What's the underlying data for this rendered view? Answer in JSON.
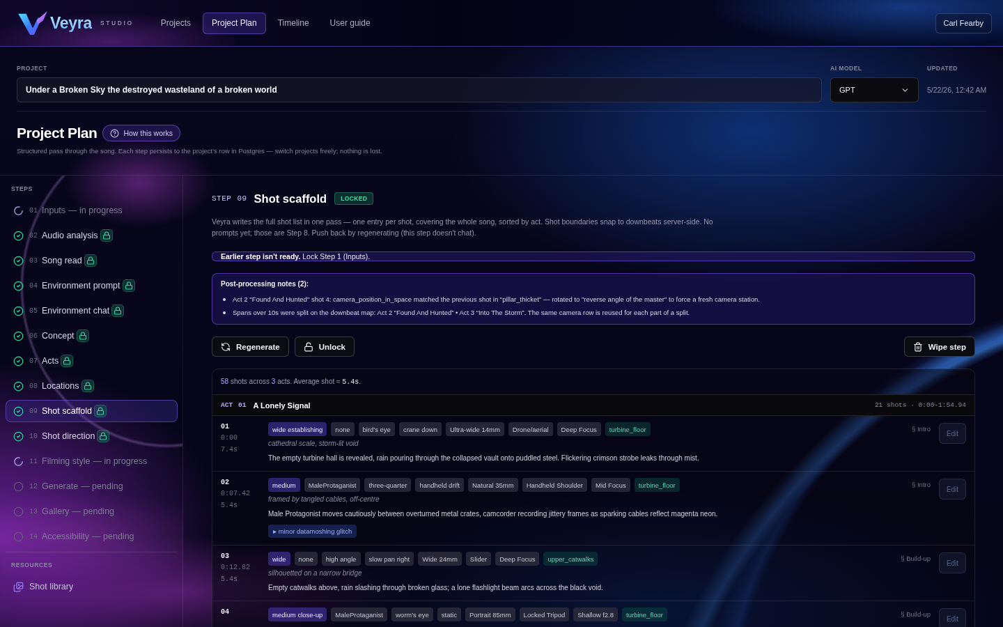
{
  "header": {
    "brand": "Veyra",
    "brand_tag": "STUDIO",
    "nav": [
      {
        "label": "Projects",
        "selected": false
      },
      {
        "label": "Project Plan",
        "selected": true
      },
      {
        "label": "Timeline",
        "selected": false
      },
      {
        "label": "User guide",
        "selected": false
      }
    ],
    "user": "Carl Fearby"
  },
  "project": {
    "name_label": "PROJECT",
    "name": "Under a Broken Sky the destroyed wasteland of a broken world",
    "model_label": "AI MODEL",
    "model": "GPT",
    "updated_label": "UPDATED",
    "updated": "5/22/26, 12:42 AM"
  },
  "page": {
    "title": "Project Plan",
    "help": "How this works",
    "subtitle": "Structured pass through the song. Each step persists to the project’s row in Postgres — switch projects freely; nothing is lost."
  },
  "sidebar": {
    "steps_label": "STEPS",
    "steps": [
      {
        "number": "01",
        "name": "Inputs",
        "note": "— in progress",
        "kind": "progress",
        "locked": false,
        "selected": false
      },
      {
        "number": "02",
        "name": "Audio analysis",
        "kind": "done",
        "locked": true,
        "selected": false
      },
      {
        "number": "03",
        "name": "Song read",
        "kind": "done",
        "locked": true,
        "selected": false
      },
      {
        "number": "04",
        "name": "Environment prompt",
        "kind": "done",
        "locked": true,
        "selected": false
      },
      {
        "number": "05",
        "name": "Environment chat",
        "kind": "done",
        "locked": true,
        "selected": false
      },
      {
        "number": "06",
        "name": "Concept",
        "kind": "done",
        "locked": true,
        "selected": false
      },
      {
        "number": "07",
        "name": "Acts",
        "kind": "done",
        "locked": true,
        "selected": false
      },
      {
        "number": "08",
        "name": "Locations",
        "kind": "done",
        "locked": true,
        "selected": false
      },
      {
        "number": "09",
        "name": "Shot scaffold",
        "kind": "done",
        "locked": true,
        "selected": true
      },
      {
        "number": "10",
        "name": "Shot direction",
        "kind": "done",
        "locked": true,
        "selected": false
      },
      {
        "number": "11",
        "name": "Filming style",
        "note": "— in progress",
        "kind": "progress",
        "locked": false,
        "selected": false
      },
      {
        "number": "12",
        "name": "Generate",
        "note": "— pending",
        "kind": "pending",
        "locked": false,
        "selected": false
      },
      {
        "number": "13",
        "name": "Gallery",
        "note": "— pending",
        "kind": "pending",
        "locked": false,
        "selected": false
      },
      {
        "number": "14",
        "name": "Accessibility",
        "note": "— pending",
        "kind": "pending",
        "locked": false,
        "selected": false
      }
    ],
    "resources_label": "RESOURCES",
    "resources": [
      {
        "label": "Shot library"
      }
    ]
  },
  "step": {
    "prefix": "STEP",
    "number": "09",
    "title": "Shot scaffold",
    "badge": "LOCKED",
    "description": "Veyra writes the full shot list in one pass — one entry per shot, covering the whole song, sorted by act. Shot boundaries snap to downbeats server-side. No prompts yet; those are Step 8. Push back by regenerating (this step doesn't chat).",
    "alert": "**Earlier step isn't ready.** Lock Step 1 (Inputs).",
    "notes": {
      "title": "Post-processing notes (2):",
      "items": [
        "Act 2 \"Found And Hunted\" shot 4: camera_position_in_space matched the previous shot in \"pillar_thicket\" — rotated to \"reverse angle of the master\" to force a fresh camera station.",
        "Spans over 10s were split on the downbeat map: Act 2 “Found And Hunted” • Act 3 “Into The Storm”. The same camera row is reused for each part of a split."
      ]
    },
    "actions": [
      {
        "label": "Regenerate",
        "kind": "regenerate"
      },
      {
        "label": "Unlock",
        "kind": "unlock"
      }
    ],
    "wipe": "Wipe step"
  },
  "shots": {
    "summary": [
      {
        "text": "58",
        "kind": "count"
      },
      {
        "text": " shots across ",
        "kind": "text"
      },
      {
        "text": "3",
        "kind": "count"
      },
      {
        "text": " acts. Average shot ≈ ",
        "kind": "text"
      },
      {
        "text": "5.4s",
        "kind": "mono"
      },
      {
        "text": ".",
        "kind": "text"
      }
    ],
    "act": {
      "label": "ACT",
      "number": "01",
      "title": "A Lonely Signal",
      "meta": "21 shots · 0:00-1:54.94"
    },
    "rows": [
      {
        "number": "01",
        "start": "0:00",
        "duration": "7.4s",
        "tags": [
          {
            "text": "wide establishing",
            "kind": "framing"
          },
          {
            "text": "none",
            "kind": "plain"
          },
          {
            "text": "bird's eye",
            "kind": "plain"
          },
          {
            "text": "crane down",
            "kind": "plain"
          },
          {
            "text": "Ultra-wide 14mm",
            "kind": "plain"
          },
          {
            "text": "Drone/aerial",
            "kind": "plain"
          },
          {
            "text": "Deep Focus",
            "kind": "plain"
          },
          {
            "text": "turbine_floor",
            "kind": "location"
          }
        ],
        "caption": "cathedral scale, storm-lit void",
        "description": "The empty turbine hall is revealed, rain pouring through the collapsed vault onto puddled steel. Flickering crimson strobe leaks through mist.",
        "section": "§ Intro",
        "edit": {
          "label": "Edit",
          "disabled": true
        }
      },
      {
        "number": "02",
        "start": "0:07.42",
        "duration": "5.4s",
        "tags": [
          {
            "text": "medium",
            "kind": "framing"
          },
          {
            "text": "MaleProtaganist",
            "kind": "plain"
          },
          {
            "text": "three-quarter",
            "kind": "plain"
          },
          {
            "text": "handheld drift",
            "kind": "plain"
          },
          {
            "text": "Natural 35mm",
            "kind": "plain"
          },
          {
            "text": "Handheld Shoulder",
            "kind": "plain"
          },
          {
            "text": "Mid Focus",
            "kind": "plain"
          },
          {
            "text": "turbine_floor",
            "kind": "location"
          }
        ],
        "caption": "framed by tangled cables, off-centre",
        "description": "Male Protagonist moves cautiously between overturned metal crates, camcorder recording jittery frames as sparking cables reflect magenta neon.",
        "effects": [
          "▸ minor datamoshing glitch"
        ],
        "section": "§ Intro",
        "edit": {
          "label": "Edit",
          "disabled": true
        }
      },
      {
        "number": "03",
        "start": "0:12.82",
        "duration": "5.4s",
        "tags": [
          {
            "text": "wide",
            "kind": "framing"
          },
          {
            "text": "none",
            "kind": "plain"
          },
          {
            "text": "high angle",
            "kind": "plain"
          },
          {
            "text": "slow pan right",
            "kind": "plain"
          },
          {
            "text": "Wide 24mm",
            "kind": "plain"
          },
          {
            "text": "Slider",
            "kind": "plain"
          },
          {
            "text": "Deep Focus",
            "kind": "plain"
          },
          {
            "text": "upper_catwalks",
            "kind": "location"
          }
        ],
        "caption": "silhouetted on a narrow bridge",
        "description": "Empty catwalks above, rain slashing through broken glass; a lone flashlight beam arcs across the black void.",
        "section": "§ Build-up",
        "edit": {
          "label": "Edit",
          "disabled": true
        }
      },
      {
        "number": "04",
        "tags": [
          {
            "text": "medium close-up",
            "kind": "framing"
          },
          {
            "text": "MaleProtaganist",
            "kind": "plain"
          },
          {
            "text": "worm's eye",
            "kind": "plain"
          },
          {
            "text": "static",
            "kind": "plain"
          },
          {
            "text": "Portrait 85mm",
            "kind": "plain"
          },
          {
            "text": "Locked Tripod",
            "kind": "plain"
          },
          {
            "text": "Shallow f2.8",
            "kind": "plain"
          },
          {
            "text": "turbine_floor",
            "kind": "location"
          }
        ],
        "section": "§ Build-up",
        "edit": {
          "label": "Edit",
          "disabled": true
        }
      }
    ]
  }
}
